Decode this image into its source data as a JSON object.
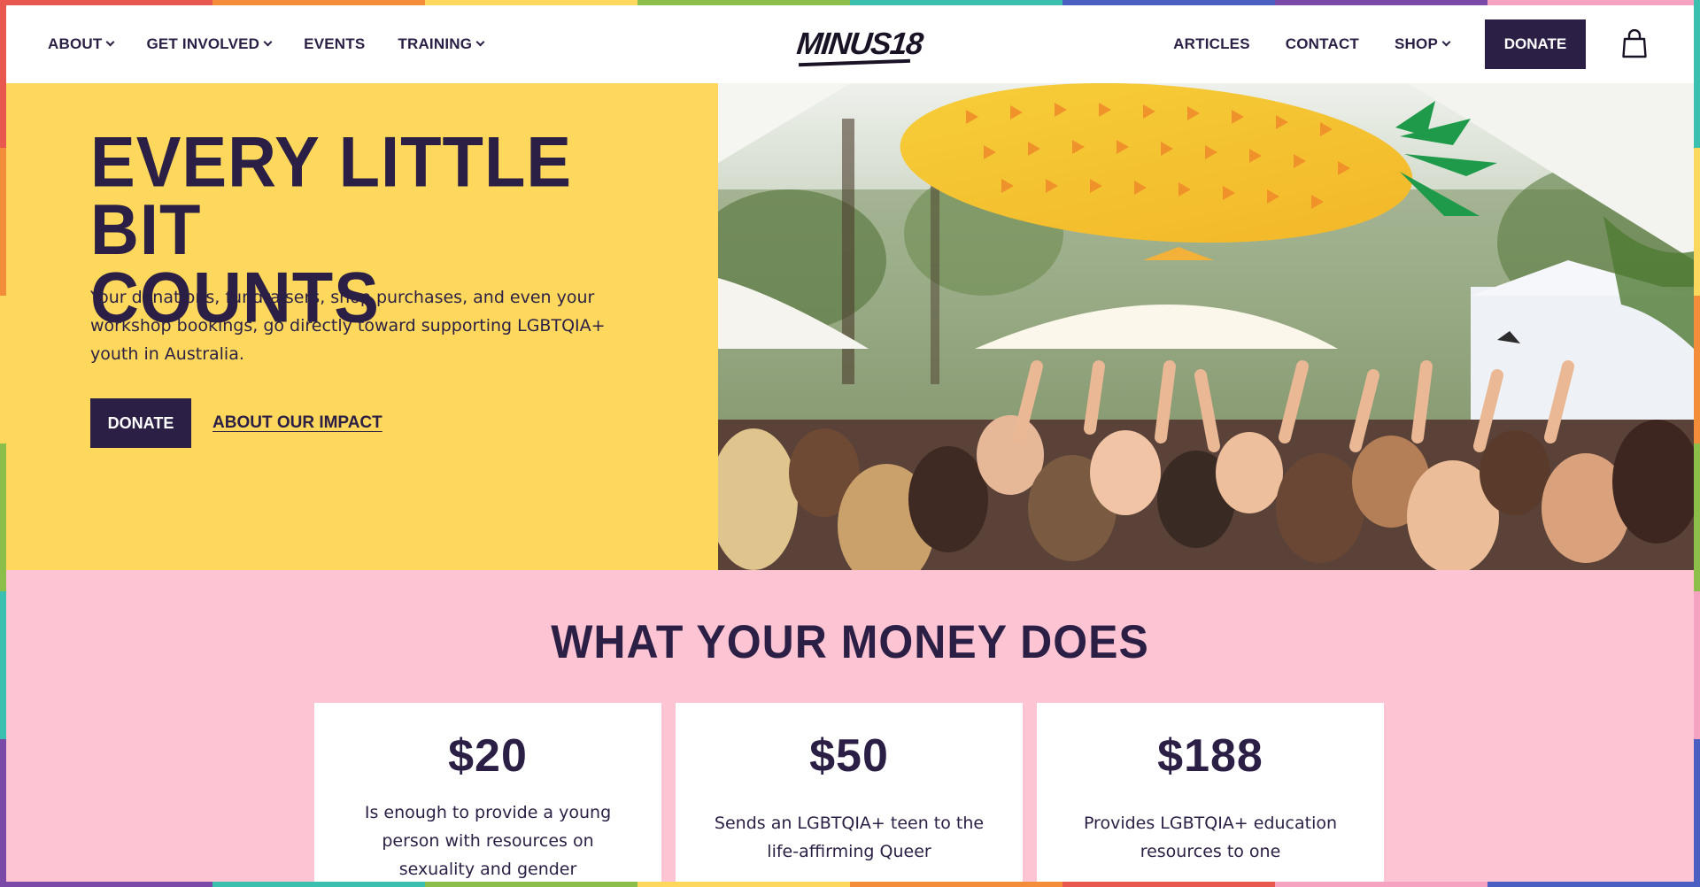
{
  "frame": {
    "colors": [
      "#e8584f",
      "#f38d3a",
      "#fdd85d",
      "#8cbf4a",
      "#3bbfae",
      "#4a5fc1",
      "#7b4aa8",
      "#f5a3c0",
      "#e8584f",
      "#f38d3a"
    ]
  },
  "header": {
    "nav_left": [
      {
        "label": "ABOUT",
        "dropdown": true
      },
      {
        "label": "GET INVOLVED",
        "dropdown": true
      },
      {
        "label": "EVENTS",
        "dropdown": false
      },
      {
        "label": "TRAINING",
        "dropdown": true
      }
    ],
    "logo_text": "MINUS18",
    "nav_right": [
      {
        "label": "ARTICLES",
        "dropdown": false
      },
      {
        "label": "CONTACT",
        "dropdown": false
      },
      {
        "label": "SHOP",
        "dropdown": true
      }
    ],
    "donate_label": "DONATE",
    "cart_icon": "shopping-bag-icon"
  },
  "hero": {
    "title_line1": "EVERY LITTLE BIT",
    "title_line2": "COUNTS",
    "text": "Your donations, fundraisers, shop purchases, and even your workshop bookings, go directly toward supporting LGBTQIA+ youth in Australia.",
    "donate_label": "DONATE",
    "impact_label": "ABOUT OUR IMPACT",
    "background_color": "#fdd85d"
  },
  "money": {
    "title": "WHAT YOUR MONEY DOES",
    "background_color": "#fdc4d3",
    "cards": [
      {
        "amount": "$20",
        "text": "Is enough to provide a young person with resources on sexuality and gender"
      },
      {
        "amount": "$50",
        "text": "Sends an LGBTQIA+ teen to the life-affirming Queer"
      },
      {
        "amount": "$188",
        "text": "Provides LGBTQIA+ education resources to one"
      }
    ]
  },
  "colors": {
    "primary": "#2b1f45",
    "yellow": "#fdd85d",
    "pink": "#fdc4d3"
  }
}
